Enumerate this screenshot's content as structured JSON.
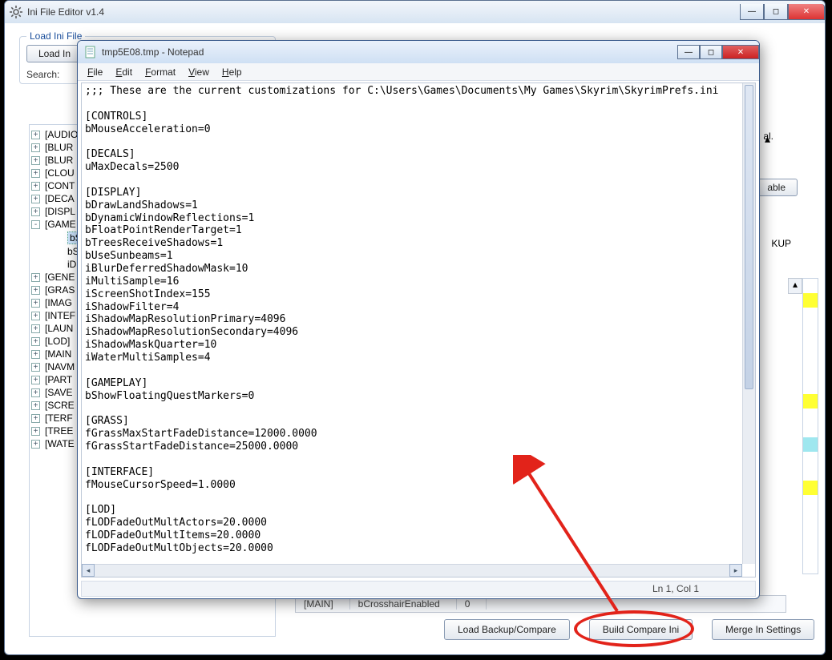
{
  "main_window": {
    "title": "Ini File Editor v1.4",
    "groupbox_title": "Load Ini File",
    "load_button": "Load In",
    "search_label": "Search:",
    "right_label_1": "al.",
    "right_button_1": "able",
    "right_label_2": "KUP",
    "tree": [
      {
        "exp": "+",
        "label": "[AUDIO",
        "type": "root"
      },
      {
        "exp": "+",
        "label": "[BLUR",
        "type": "root"
      },
      {
        "exp": "+",
        "label": "[BLUR",
        "type": "root"
      },
      {
        "exp": "+",
        "label": "[CLOU",
        "type": "root"
      },
      {
        "exp": "+",
        "label": "[CONT",
        "type": "root"
      },
      {
        "exp": "+",
        "label": "[DECA",
        "type": "root"
      },
      {
        "exp": "+",
        "label": "[DISPL",
        "type": "root"
      },
      {
        "exp": "-",
        "label": "[GAME",
        "type": "root"
      },
      {
        "exp": "",
        "label": "bS",
        "type": "child",
        "selected": true
      },
      {
        "exp": "",
        "label": "bS",
        "type": "child"
      },
      {
        "exp": "",
        "label": "iDi",
        "type": "child"
      },
      {
        "exp": "+",
        "label": "[GENE",
        "type": "root"
      },
      {
        "exp": "+",
        "label": "[GRAS",
        "type": "root"
      },
      {
        "exp": "+",
        "label": "[IMAG",
        "type": "root"
      },
      {
        "exp": "+",
        "label": "[INTEF",
        "type": "root"
      },
      {
        "exp": "+",
        "label": "[LAUN",
        "type": "root"
      },
      {
        "exp": "+",
        "label": "[LOD]",
        "type": "root"
      },
      {
        "exp": "+",
        "label": "[MAIN",
        "type": "root"
      },
      {
        "exp": "+",
        "label": "[NAVM",
        "type": "root"
      },
      {
        "exp": "+",
        "label": "[PART",
        "type": "root"
      },
      {
        "exp": "+",
        "label": "[SAVE",
        "type": "root"
      },
      {
        "exp": "+",
        "label": "[SCRE",
        "type": "root"
      },
      {
        "exp": "+",
        "label": "[TERF",
        "type": "root"
      },
      {
        "exp": "+",
        "label": "[TREE",
        "type": "root"
      },
      {
        "exp": "+",
        "label": "[WATE",
        "type": "root"
      }
    ],
    "bottom_row": {
      "c1": "[MAIN]",
      "c2": "bCrosshairEnabled",
      "c3": "0"
    },
    "buttons": {
      "load_backup": "Load Backup/Compare",
      "build_compare": "Build Compare Ini",
      "merge": "Merge In Settings"
    }
  },
  "notepad": {
    "title": "tmp5E08.tmp - Notepad",
    "menus": [
      "File",
      "Edit",
      "Format",
      "View",
      "Help"
    ],
    "status": "Ln 1, Col 1",
    "text": ";;; These are the current customizations for C:\\Users\\Games\\Documents\\My Games\\Skyrim\\SkyrimPrefs.ini\n\n[CONTROLS]\nbMouseAcceleration=0\n\n[DECALS]\nuMaxDecals=2500\n\n[DISPLAY]\nbDrawLandShadows=1\nbDynamicWindowReflections=1\nbFloatPointRenderTarget=1\nbTreesReceiveShadows=1\nbUseSunbeams=1\niBlurDeferredShadowMask=10\niMultiSample=16\niScreenShotIndex=155\niShadowFilter=4\niShadowMapResolutionPrimary=4096\niShadowMapResolutionSecondary=4096\niShadowMaskQuarter=10\niWaterMultiSamples=4\n\n[GAMEPLAY]\nbShowFloatingQuestMarkers=0\n\n[GRASS]\nfGrassMaxStartFadeDistance=12000.0000\nfGrassStartFadeDistance=25000.0000\n\n[INTERFACE]\nfMouseCursorSpeed=1.0000\n\n[LOD]\nfLODFadeOutMultActors=20.0000\nfLODFadeOutMultItems=20.0000\nfLODFadeOutMultObjects=20.0000"
  },
  "color_marks": [
    "",
    "yel",
    "",
    "",
    "",
    "",
    "",
    "",
    "yel",
    "",
    "",
    "cya",
    "",
    "",
    "yel",
    ""
  ]
}
